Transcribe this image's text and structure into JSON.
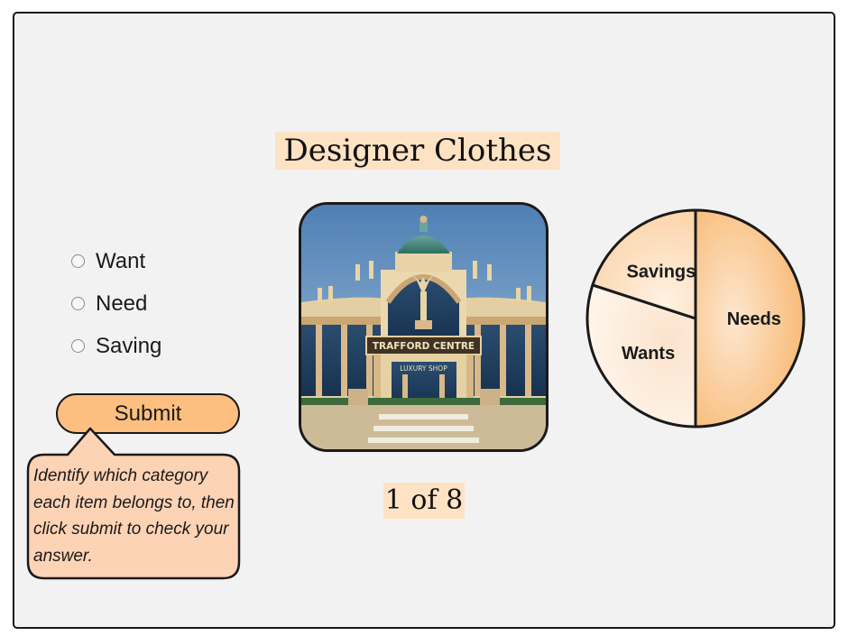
{
  "item": {
    "title": "Designer Clothes",
    "image_sign": "TRAFFORD CENTRE",
    "image_subsign": "LUXURY SHOP"
  },
  "options": [
    {
      "label": "Want",
      "selected": false
    },
    {
      "label": "Need",
      "selected": false
    },
    {
      "label": "Saving",
      "selected": false
    }
  ],
  "submit_label": "Submit",
  "instructions": "Identify which category each item belongs to, then click submit to check your answer.",
  "progress": {
    "text": "1 of 8",
    "current": 1,
    "total": 8
  },
  "categories_pie": {
    "slices": [
      {
        "label": "Needs",
        "share": 50
      },
      {
        "label": "Wants",
        "share": 30
      },
      {
        "label": "Savings",
        "share": 20
      }
    ]
  },
  "colors": {
    "accent": "#fcbf80",
    "highlight": "#fde2c4",
    "tooltip": "#fdd3b5",
    "background": "#f2f2f2"
  }
}
